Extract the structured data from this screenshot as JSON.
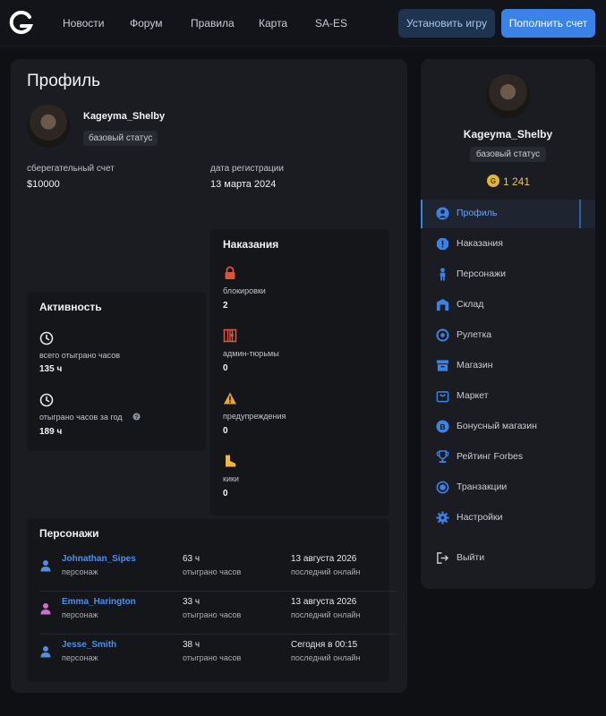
{
  "colors": {
    "accent": "#3b82e6",
    "link": "#4f8fe8",
    "danger": "#d9543f",
    "warning": "#e8a33a",
    "coin": "#e3b634"
  },
  "nav": {
    "items": [
      "Новости",
      "Форум",
      "Правила",
      "Карта",
      "SA-ES"
    ],
    "install_label": "Установить игру",
    "topup_label": "Пополнить счет"
  },
  "profile": {
    "title": "Профиль",
    "username": "Kageyma_Shelby",
    "status": "базовый статус",
    "savings_label": "сберегательный счет",
    "savings_value": "$10000",
    "reg_label": "дата регистрации",
    "reg_value": "13 марта 2024"
  },
  "activity": {
    "title": "Активность",
    "total_label": "всего отыграно часов",
    "total_value": "135 ч",
    "year_label": "отыграно часов за год",
    "year_value": "189 ч"
  },
  "punishments": {
    "title": "Наказания",
    "items": [
      {
        "icon": "lock-icon",
        "label": "блокировки",
        "value": "2"
      },
      {
        "icon": "jail-icon",
        "label": "админ-тюрьмы",
        "value": "0"
      },
      {
        "icon": "warning-icon",
        "label": "предупреждения",
        "value": "0"
      },
      {
        "icon": "boot-icon",
        "label": "кики",
        "value": "0"
      }
    ]
  },
  "characters": {
    "title": "Персонажи",
    "rows": [
      {
        "name": "Johnathan_Sipes",
        "role": "персонаж",
        "hours": "63 ч",
        "hours_label": "отыграно часов",
        "online": "13 августа 2026",
        "online_label": "последний онлайн",
        "icon_color": "#4f8fe8"
      },
      {
        "name": "Emma_Harington",
        "role": "персонаж",
        "hours": "33 ч",
        "hours_label": "отыграно часов",
        "online": "13 августа 2026",
        "online_label": "последний онлайн",
        "icon_color": "#d46bd4"
      },
      {
        "name": "Jesse_Smith",
        "role": "персонаж",
        "hours": "38 ч",
        "hours_label": "отыграно часов",
        "online": "Сегодня в 00:15",
        "online_label": "последний онлайн",
        "icon_color": "#4f8fe8"
      }
    ]
  },
  "sidebar": {
    "username": "Kageyma_Shelby",
    "status": "базовый статус",
    "coin_symbol": "G",
    "coin_value": "1 241",
    "items": [
      {
        "label": "Профиль",
        "icon": "user-circle-icon",
        "active": true
      },
      {
        "label": "Наказания",
        "icon": "alert-icon",
        "active": false
      },
      {
        "label": "Персонажи",
        "icon": "person-icon",
        "active": false
      },
      {
        "label": "Склад",
        "icon": "warehouse-icon",
        "active": false
      },
      {
        "label": "Рулетка",
        "icon": "roulette-icon",
        "active": false
      },
      {
        "label": "Магазин",
        "icon": "store-icon",
        "active": false
      },
      {
        "label": "Маркет",
        "icon": "bag-icon",
        "active": false
      },
      {
        "label": "Бонусный магазин",
        "icon": "bonus-icon",
        "active": false
      },
      {
        "label": "Рейтинг Forbes",
        "icon": "trophy-icon",
        "active": false
      },
      {
        "label": "Транзакции",
        "icon": "transactions-icon",
        "active": false
      },
      {
        "label": "Настройки",
        "icon": "gear-icon",
        "active": false
      }
    ],
    "logout_label": "Выйти"
  }
}
